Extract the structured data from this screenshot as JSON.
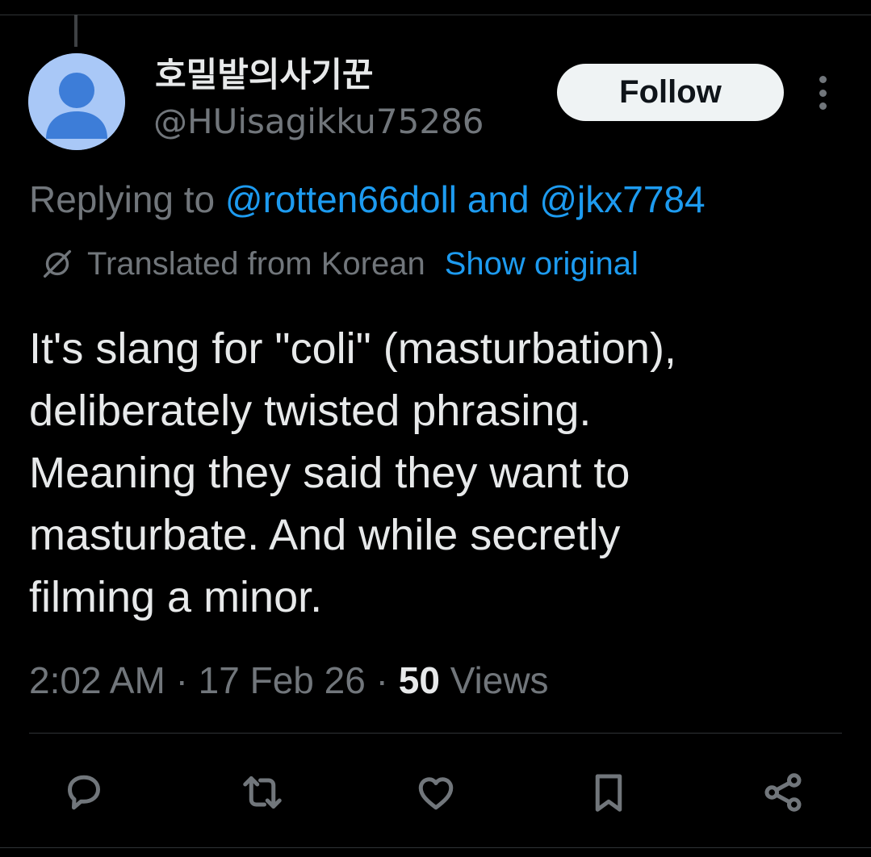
{
  "author": {
    "display_name": "호밀밭의사기꾼",
    "handle": "@HUisagikku75286",
    "avatar_color": "#a9c8f7",
    "avatar_icon": "default-person-icon"
  },
  "follow_button": {
    "label": "Follow"
  },
  "more_menu": {
    "icon": "more-vertical-icon"
  },
  "reply_context": {
    "prefix": "Replying to",
    "mention_1": "@rotten66doll",
    "conjunction": "and",
    "mention_2": "@jkx7784"
  },
  "translation": {
    "icon": "globe-icon",
    "label": "Translated from Korean",
    "show_original": "Show original"
  },
  "tweet": {
    "lines": [
      "It's slang for \"coli\" (masturbation),",
      "deliberately twisted phrasing.",
      "Meaning they said they want to",
      "masturbate. And while secretly",
      "filming a minor."
    ]
  },
  "meta": {
    "time": "2:02 AM",
    "separator": "·",
    "date": "17 Feb 26",
    "views_count": "50",
    "views_label": "Views"
  },
  "actions": [
    {
      "icon": "reply-icon"
    },
    {
      "icon": "retweet-icon"
    },
    {
      "icon": "like-icon"
    },
    {
      "icon": "bookmark-icon"
    },
    {
      "icon": "share-icon"
    }
  ],
  "colors": {
    "background": "#000000",
    "text_primary": "#e7e9ea",
    "text_secondary": "#71767b",
    "accent": "#1d9bf0",
    "border": "#2f3336"
  }
}
